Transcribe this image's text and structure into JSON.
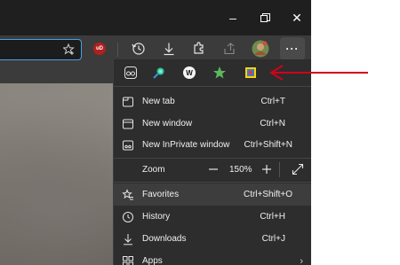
{
  "window": {
    "minimize_label": "–",
    "restore_label": "❐",
    "close_label": "✕"
  },
  "toolbar": {
    "extension_badge": "uD",
    "icons": [
      "favorites-star-icon",
      "ublock-origin-icon",
      "history-icon",
      "downloads-icon",
      "extensions-icon",
      "share-icon",
      "profile-avatar",
      "more-options-icon"
    ],
    "more_label": "···"
  },
  "menu": {
    "extensions": [
      "reading-glasses-extension",
      "search-extension",
      "w-extension",
      "star-extension",
      "color-picker-extension"
    ],
    "extension_w_label": "W",
    "items": [
      {
        "label": "New tab",
        "shortcut": "Ctrl+T",
        "icon": "new-tab-icon"
      },
      {
        "label": "New window",
        "shortcut": "Ctrl+N",
        "icon": "new-window-icon"
      },
      {
        "label": "New InPrivate window",
        "shortcut": "Ctrl+Shift+N",
        "icon": "inprivate-icon"
      }
    ],
    "zoom": {
      "label": "Zoom",
      "value": "150%",
      "minus": "—",
      "plus": "+"
    },
    "items2": [
      {
        "label": "Favorites",
        "shortcut": "Ctrl+Shift+O",
        "icon": "favorites-icon"
      },
      {
        "label": "History",
        "shortcut": "Ctrl+H",
        "icon": "history-icon"
      },
      {
        "label": "Downloads",
        "shortcut": "Ctrl+J",
        "icon": "downloads-icon"
      },
      {
        "label": "Apps",
        "shortcut": "",
        "icon": "apps-icon"
      }
    ],
    "apps_chevron": "›"
  },
  "colors": {
    "accent": "#4aa0e6",
    "arrow": "#d0021b",
    "menu_bg": "#2d2d2d",
    "hover_bg": "#3d3d3d"
  }
}
